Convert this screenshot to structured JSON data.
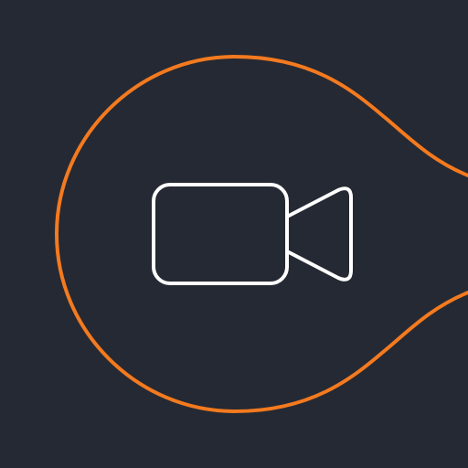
{
  "icon": {
    "glyph": "video-camera-icon",
    "frame": "bulb-outline",
    "colors": {
      "background": "#252933",
      "frame_stroke": "#F47A1F",
      "glyph_stroke": "#FFFFFF"
    }
  }
}
